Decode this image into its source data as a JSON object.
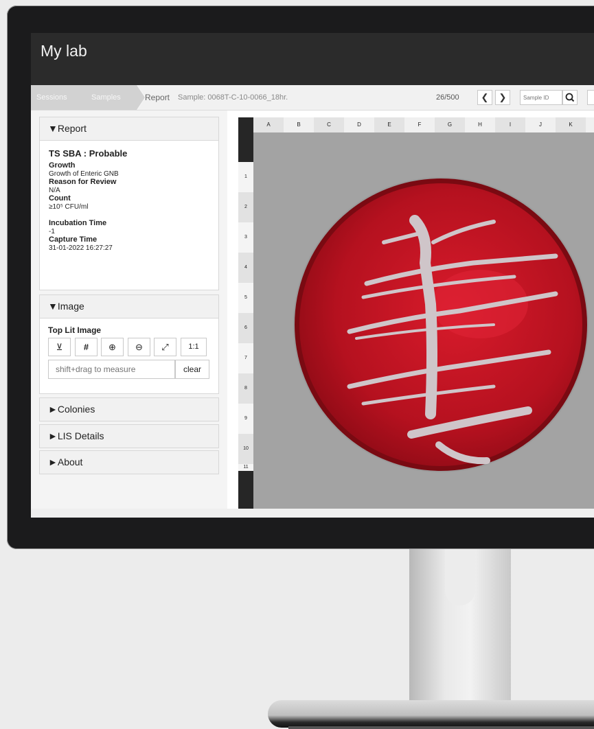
{
  "app": {
    "title": "My lab"
  },
  "breadcrumb": {
    "sessions": "Sessions",
    "samples": "Samples",
    "report": "Report",
    "sample_label": "Sample: 0068T-C-10-0066_18hr."
  },
  "navigation": {
    "counter": "26/500",
    "prev_icon": "chevron-left-icon",
    "next_icon": "chevron-right-icon",
    "sample_id_placeholder": "Sample ID",
    "search_icon": "search-icon"
  },
  "report_panel": {
    "header": "▼Report",
    "result": "TS SBA : Probable",
    "growth_label": "Growth",
    "growth_value": "Growth of Enteric GNB",
    "reason_label": "Reason for Review",
    "reason_value": "N/A",
    "count_label": "Count",
    "count_value": "≥10⁵ CFU/ml",
    "incubation_label": "Incubation Time",
    "incubation_value": "-1",
    "capture_label": "Capture Time",
    "capture_value": "31-01-2022 16:27:27"
  },
  "image_panel": {
    "header": "▼Image",
    "title": "Top Lit Image",
    "tools": [
      {
        "name": "baseline-icon",
        "glyph": "⊻"
      },
      {
        "name": "grid-icon",
        "glyph": "#"
      },
      {
        "name": "zoom-in-icon",
        "glyph": "⊕"
      },
      {
        "name": "zoom-out-icon",
        "glyph": "⊖"
      },
      {
        "name": "fullscreen-icon",
        "glyph": "⤢"
      },
      {
        "name": "actual-size",
        "glyph": "1:1"
      }
    ],
    "measure_placeholder": "shift+drag to measure",
    "clear_label": "clear"
  },
  "collapsed_panels": {
    "colonies": "►Colonies",
    "lis_details": "►LIS Details",
    "about": "►About"
  },
  "grid": {
    "columns": [
      "A",
      "B",
      "C",
      "D",
      "E",
      "F",
      "G",
      "H",
      "I",
      "J",
      "K"
    ],
    "rows": [
      "1",
      "2",
      "3",
      "4",
      "5",
      "6",
      "7",
      "8",
      "9",
      "10",
      "11"
    ]
  },
  "colors": {
    "header_bg": "#2b2b2b",
    "agar_red": "#b8121f",
    "colony": "#c9c0c4",
    "image_bg": "#a3a3a3"
  }
}
